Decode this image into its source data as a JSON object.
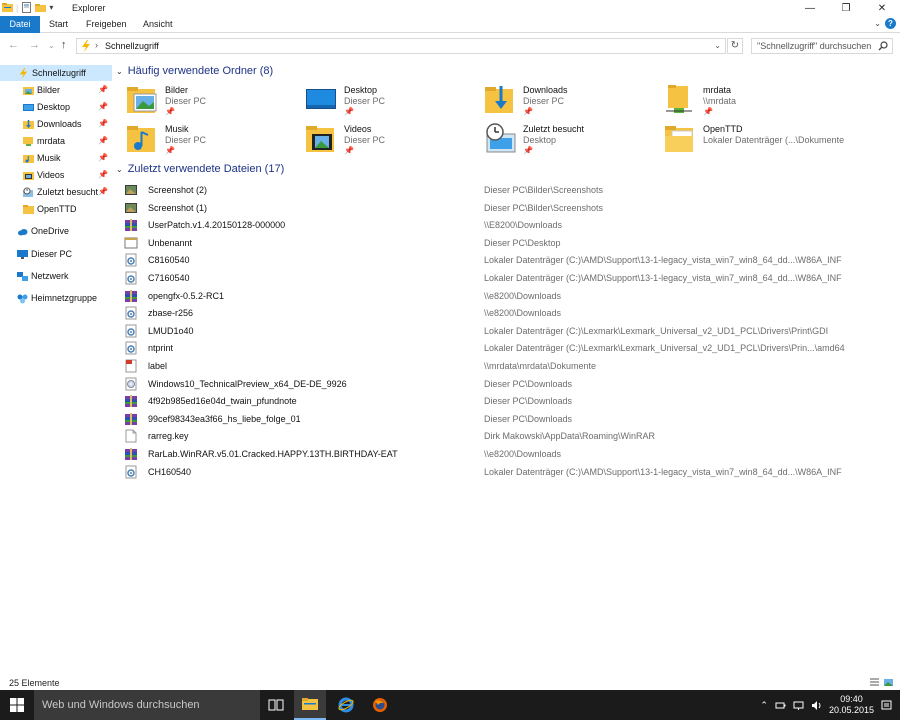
{
  "window": {
    "title": "Explorer"
  },
  "ribbon": {
    "tabs": [
      "Datei",
      "Start",
      "Freigeben",
      "Ansicht"
    ]
  },
  "address": {
    "location": "Schnellzugriff",
    "search_placeholder": "\"Schnellzugriff\" durchsuchen"
  },
  "sidebar": {
    "quick_access": "Schnellzugriff",
    "pinned": [
      "Bilder",
      "Desktop",
      "Downloads",
      "mrdata",
      "Musik",
      "Videos",
      "Zuletzt besucht"
    ],
    "recent": "OpenTTD",
    "onedrive": "OneDrive",
    "thispc": "Dieser PC",
    "network": "Netzwerk",
    "homegroup": "Heimnetzgruppe"
  },
  "frequent": {
    "header": "Häufig verwendete Ordner (8)",
    "folders": [
      {
        "name": "Bilder",
        "location": "Dieser PC",
        "icon": "pictures-folder-icon"
      },
      {
        "name": "Desktop",
        "location": "Dieser PC",
        "icon": "desktop-folder-icon"
      },
      {
        "name": "Downloads",
        "location": "Dieser PC",
        "icon": "downloads-folder-icon"
      },
      {
        "name": "mrdata",
        "location": "\\\\mrdata",
        "icon": "network-folder-icon"
      },
      {
        "name": "Musik",
        "location": "Dieser PC",
        "icon": "music-folder-icon"
      },
      {
        "name": "Videos",
        "location": "Dieser PC",
        "icon": "videos-folder-icon"
      },
      {
        "name": "Zuletzt besucht",
        "location": "Desktop",
        "icon": "recent-places-icon"
      },
      {
        "name": "OpenTTD",
        "location": "Lokaler Datenträger (...\\Dokumente",
        "icon": "folder-icon"
      }
    ]
  },
  "recent_files": {
    "header": "Zuletzt verwendete Dateien (17)",
    "files": [
      {
        "name": "Screenshot (2)",
        "path": "Dieser PC\\Bilder\\Screenshots",
        "icon": "image-file-icon"
      },
      {
        "name": "Screenshot (1)",
        "path": "Dieser PC\\Bilder\\Screenshots",
        "icon": "image-file-icon"
      },
      {
        "name": "UserPatch.v1.4.20150128-000000",
        "path": "\\\\E8200\\Downloads",
        "icon": "archive-file-icon"
      },
      {
        "name": "Unbenannt",
        "path": "Dieser PC\\Desktop",
        "icon": "blank-image-icon"
      },
      {
        "name": "C8160540",
        "path": "Lokaler Datenträger (C:)\\AMD\\Support\\13-1-legacy_vista_win7_win8_64_dd...\\W86A_INF",
        "icon": "settings-file-icon"
      },
      {
        "name": "C7160540",
        "path": "Lokaler Datenträger (C:)\\AMD\\Support\\13-1-legacy_vista_win7_win8_64_dd...\\W86A_INF",
        "icon": "settings-file-icon"
      },
      {
        "name": "opengfx-0.5.2-RC1",
        "path": "\\\\e8200\\Downloads",
        "icon": "archive-file-icon"
      },
      {
        "name": "zbase-r256",
        "path": "\\\\e8200\\Downloads",
        "icon": "settings-file-icon"
      },
      {
        "name": "LMUD1o40",
        "path": "Lokaler Datenträger (C:)\\Lexmark\\Lexmark_Universal_v2_UD1_PCL\\Drivers\\Print\\GDI",
        "icon": "settings-file-icon"
      },
      {
        "name": "ntprint",
        "path": "Lokaler Datenträger (C:)\\Lexmark\\Lexmark_Universal_v2_UD1_PCL\\Drivers\\Prin...\\amd64",
        "icon": "settings-file-icon"
      },
      {
        "name": "label",
        "path": "\\\\mrdata\\mrdata\\Dokumente",
        "icon": "pdf-file-icon"
      },
      {
        "name": "Windows10_TechnicalPreview_x64_DE-DE_9926",
        "path": "Dieser PC\\Downloads",
        "icon": "disc-image-icon"
      },
      {
        "name": "4f92b985ed16e04d_twain_pfundnote",
        "path": "Dieser PC\\Downloads",
        "icon": "archive-file-icon"
      },
      {
        "name": "99cef98343ea3f66_hs_liebe_folge_01",
        "path": "Dieser PC\\Downloads",
        "icon": "archive-file-icon"
      },
      {
        "name": "rarreg.key",
        "path": "Dirk Makowski\\AppData\\Roaming\\WinRAR",
        "icon": "generic-file-icon"
      },
      {
        "name": "RarLab.WinRAR.v5.01.Cracked.HAPPY.13TH.BIRTHDAY-EAT",
        "path": "\\\\e8200\\Downloads",
        "icon": "archive-file-icon"
      },
      {
        "name": "CH160540",
        "path": "Lokaler Datenträger (C:)\\AMD\\Support\\13-1-legacy_vista_win7_win8_64_dd...\\W86A_INF",
        "icon": "settings-file-icon"
      }
    ]
  },
  "status": {
    "count": "25 Elemente"
  },
  "taskbar": {
    "search": "Web und Windows durchsuchen",
    "time": "09:40",
    "date": "20.05.2015"
  },
  "colors": {
    "accent": "#1979ca",
    "header": "#1e3287",
    "folder": "#f5c242",
    "taskbar": "#1b1b1b"
  }
}
